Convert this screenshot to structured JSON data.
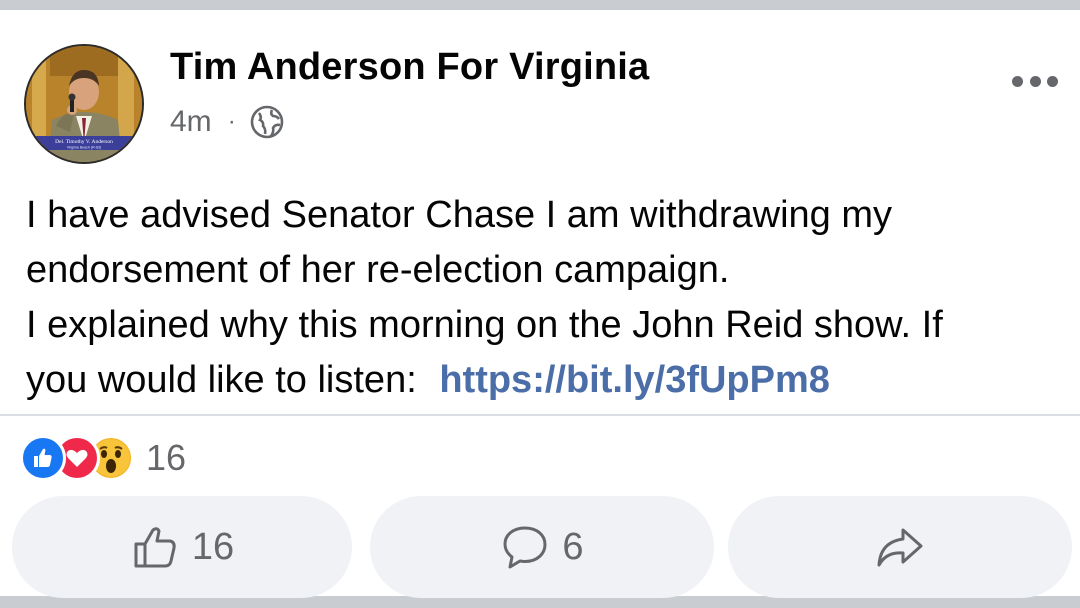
{
  "post": {
    "author": "Tim Anderson For Virginia",
    "time": "4m",
    "separator": "·",
    "privacy_icon": "globe-icon",
    "more_icon": "more-horizontal-icon",
    "avatar_caption_line1": "Del. Timothy V. Anderson",
    "avatar_caption_line2": "Virginia Beach (R-83)",
    "text_lines": [
      "I have advised Senator Chase I am withdrawing my",
      "endorsement of her re-election campaign.",
      "I explained why this morning on the John Reid show. If",
      "you would like to listen: "
    ],
    "link": "https://bit.ly/3fUpPm8"
  },
  "reactions": {
    "icons": [
      "like-reaction-icon",
      "love-reaction-icon",
      "wow-reaction-icon"
    ],
    "count": "16"
  },
  "actions": {
    "like_count": "16",
    "comment_count": "6",
    "share_icon": "share-icon"
  },
  "colors": {
    "link": "#4b6ea8",
    "like_blue": "#1877f2",
    "love_red": "#f02849",
    "wow_yellow": "#f7b125",
    "muted_text": "#65676b",
    "button_bg": "#f0f2f5"
  }
}
